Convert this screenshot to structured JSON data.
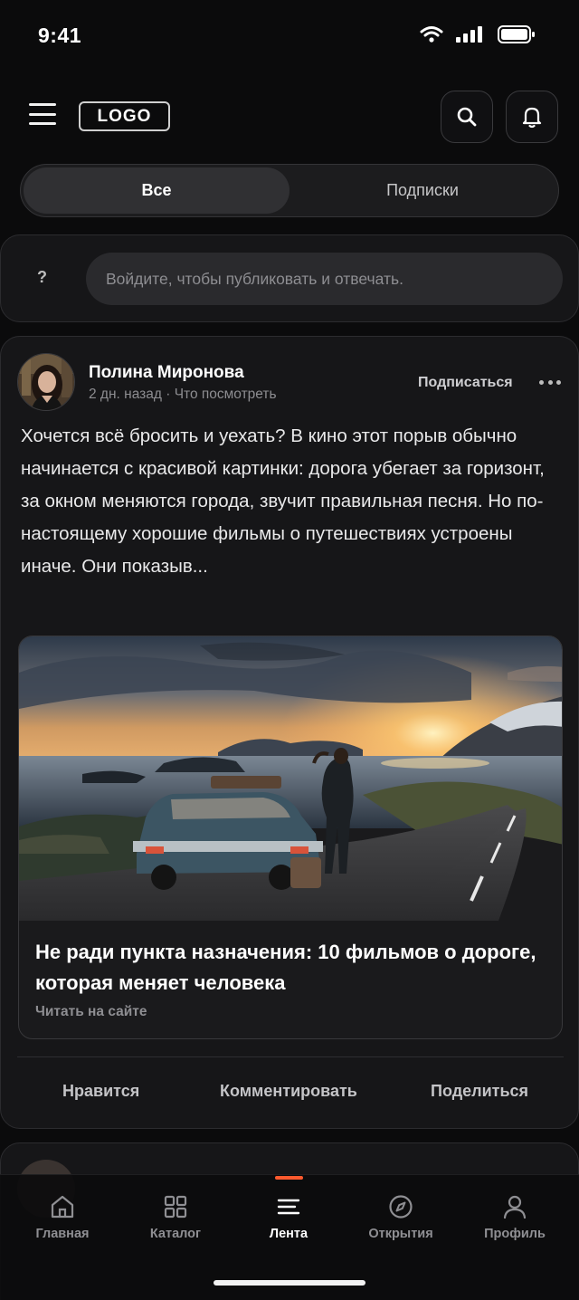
{
  "status_bar": {
    "time": "9:41"
  },
  "header": {
    "logo": "LOGO"
  },
  "tabs": [
    {
      "label": "Все",
      "active": true
    },
    {
      "label": "Подписки",
      "active": false
    }
  ],
  "composer": {
    "avatar_placeholder": "?",
    "prompt": "Войдите, чтобы публиковать и отвечать."
  },
  "post": {
    "author": "Полина Миронова",
    "meta": "2 дн. назад · Что посмотреть",
    "subscribe_label": "Подписаться",
    "text": "Хочется всё бросить и уехать? В кино этот порыв обычно начинается с красивой картинки: дорога убегает за горизонт, за окном меняются города, звучит правильная песня. Но по-настоящему хорошие фильмы о путешествиях устроены иначе. Они показыв...",
    "link": {
      "title": "Не ради пункта назначения: 10 фильмов о дороге, которая меняет человека",
      "source": "Читать на сайте"
    },
    "actions": {
      "like": "Нравится",
      "comment": "Комментировать",
      "share": "Поделиться"
    }
  },
  "bottom_nav": {
    "items": [
      {
        "label": "Главная",
        "icon": "home-icon"
      },
      {
        "label": "Каталог",
        "icon": "grid-icon"
      },
      {
        "label": "Лента",
        "icon": "feed-icon",
        "active": true
      },
      {
        "label": "Открытия",
        "icon": "compass-icon"
      },
      {
        "label": "Профиль",
        "icon": "profile-icon"
      }
    ],
    "accent": "#ff5a2e"
  }
}
